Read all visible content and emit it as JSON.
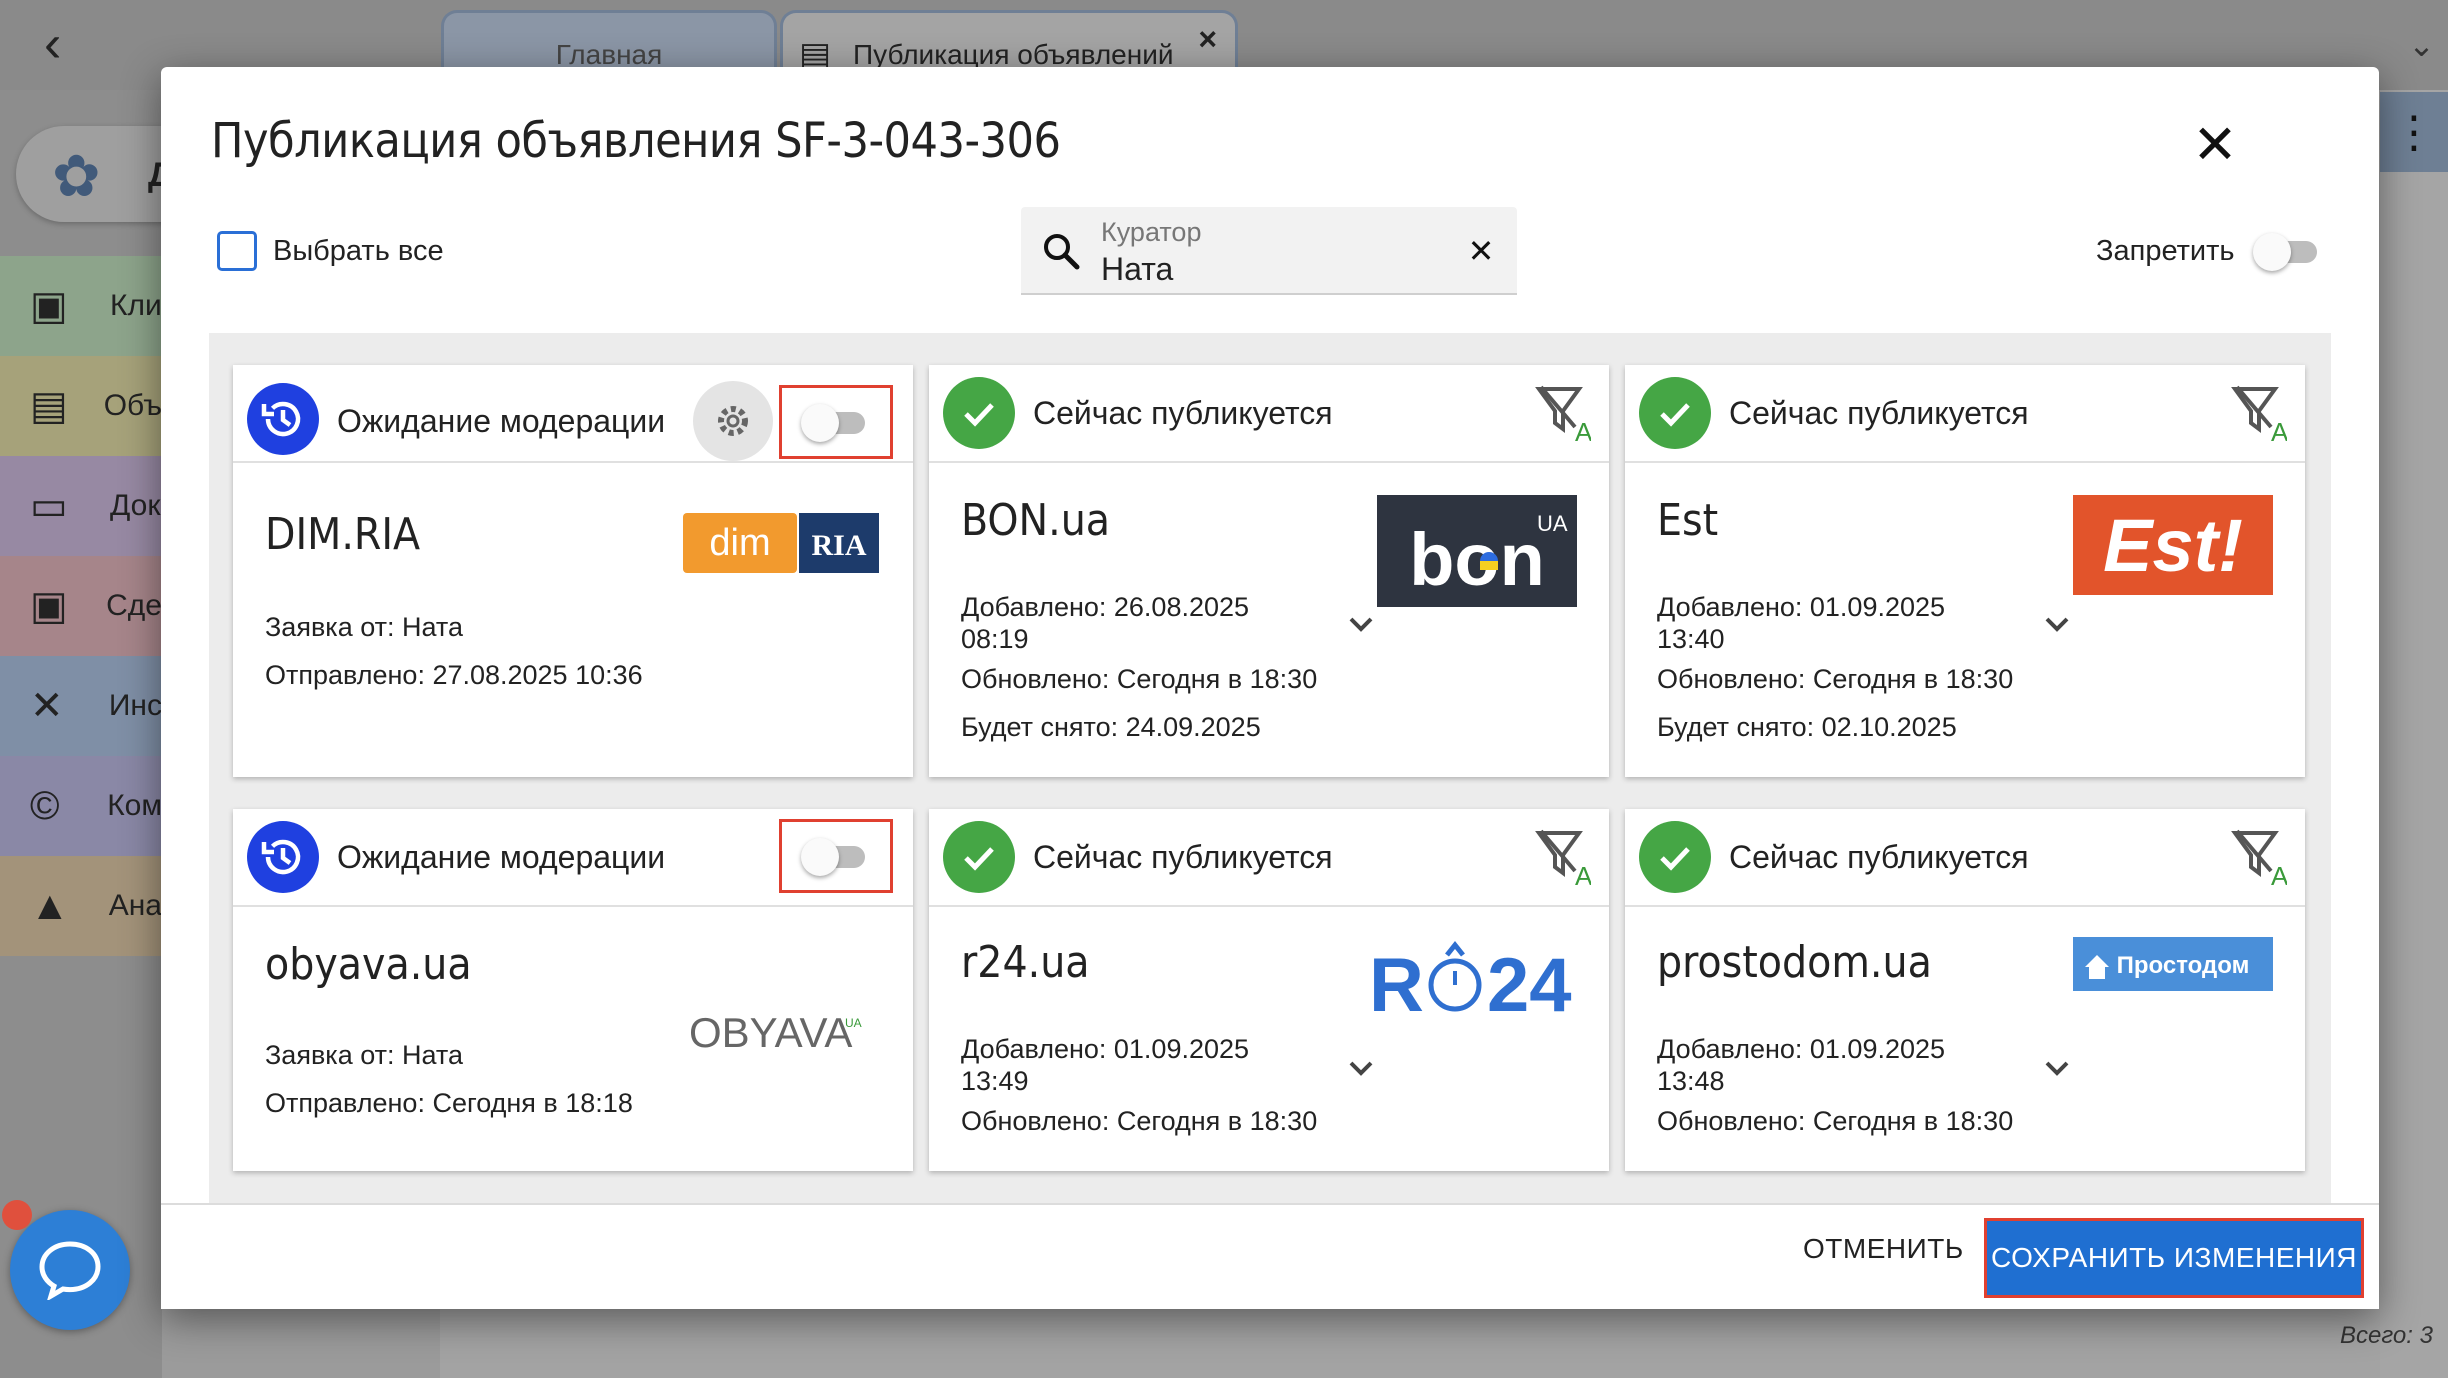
{
  "background": {
    "tabs": [
      {
        "label": "Главная"
      },
      {
        "label": "Публикация объявлений"
      }
    ],
    "sidebar_items": [
      "Кли",
      "Объ",
      "Док",
      "Сде",
      "Инс",
      "Ком",
      "Ана"
    ],
    "logo_text": "ДС",
    "total": "Всего: 3"
  },
  "modal": {
    "title": "Публикация объявления SF-3-043-306",
    "select_all_label": "Выбрать все",
    "search": {
      "label": "Куратор",
      "value": "Ната"
    },
    "forbid_label": "Запретить",
    "cards": [
      {
        "status": "Ожидание модерации",
        "site": "DIM.RIA",
        "logo": "dim RIA",
        "lines": [
          "Заявка от: Ната",
          "Отправлено: 27.08.2025 10:36"
        ]
      },
      {
        "status": "Сейчас публикуется",
        "site": "BON.ua",
        "logo": "bon",
        "lines": [
          "Добавлено: 26.08.2025",
          "08:19",
          "Обновлено: Сегодня в 18:30",
          "Будет снято: 24.09.2025"
        ]
      },
      {
        "status": "Сейчас публикуется",
        "site": "Est",
        "logo": "Est!",
        "lines": [
          "Добавлено: 01.09.2025",
          "13:40",
          "Обновлено: Сегодня в 18:30",
          "Будет снято: 02.10.2025"
        ]
      },
      {
        "status": "Ожидание модерации",
        "site": "obyava.ua",
        "logo": "OBYAVA",
        "lines": [
          "Заявка от: Ната",
          "Отправлено: Сегодня в 18:18"
        ]
      },
      {
        "status": "Сейчас публикуется",
        "site": "r24.ua",
        "logo": "R24",
        "lines": [
          "Добавлено: 01.09.2025",
          "13:49",
          "Обновлено: Сегодня в 18:30"
        ]
      },
      {
        "status": "Сейчас публикуется",
        "site": "prostodom.ua",
        "logo": "Простодом",
        "lines": [
          "Добавлено: 01.09.2025",
          "13:48",
          "Обновлено: Сегодня в 18:30"
        ]
      }
    ],
    "cancel_label": "ОТМЕНИТЬ",
    "save_label": "СОХРАНИТЬ ИЗМЕНЕНИЯ"
  },
  "colors": {
    "accent": "#1f6fd1",
    "pending": "#1f40e0",
    "published": "#45a645",
    "highlight": "#e04030"
  }
}
